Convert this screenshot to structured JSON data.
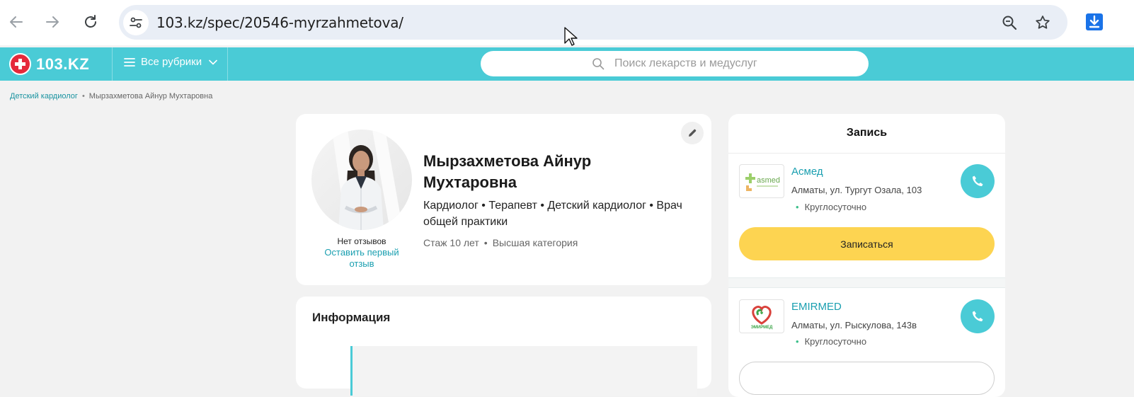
{
  "browser": {
    "url": "103.kz/spec/20546-myrzahmetova/",
    "icons": [
      "back-arrow-icon",
      "forward-arrow-icon",
      "reload-icon",
      "site-info-icon",
      "zoom-icon",
      "bookmark-star-icon",
      "download-icon"
    ]
  },
  "header": {
    "logo_text": "103.KZ",
    "rubrics_label": "Все рубрики",
    "search_placeholder": "Поиск лекарств и медуслуг",
    "brand_color": "#4acbd6"
  },
  "breadcrumb": {
    "items": [
      "Детский кардиолог",
      "Мырзахметова Айнур Мухтаровна"
    ]
  },
  "profile": {
    "name": "Мырзахметова Айнур Мухтаровна",
    "specialties": "Кардиолог • Терапевт • Детский кардиолог • Врач общей практики",
    "experience": "Стаж 10 лет",
    "category": "Высшая категория",
    "meta_separator": "•",
    "no_reviews": "Нет отзывов",
    "leave_review": "Оставить первый отзыв"
  },
  "info": {
    "title": "Информация"
  },
  "booking": {
    "title": "Запись",
    "book_label": "Записаться",
    "button_color": "#fdd451",
    "clinics": [
      {
        "name": "Асмед",
        "address": "Алматы, ул. Тургут Озала, 103",
        "hours": "Круглосуточно",
        "logo_text": "asmed"
      },
      {
        "name": "EMIRMED",
        "address": "Алматы, ул. Рыскулова, 143в",
        "hours": "Круглосуточно",
        "logo_text": "ЭМИРМЕД"
      }
    ]
  }
}
